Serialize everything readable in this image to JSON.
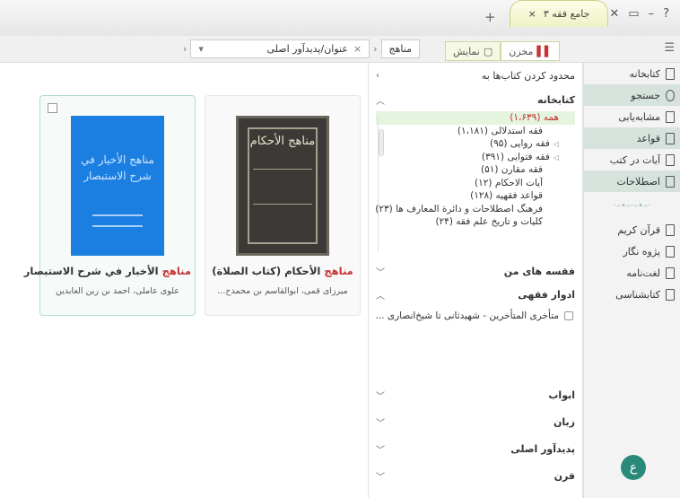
{
  "window": {
    "app_tab_title": "جامع فقه ۳",
    "controls": [
      "?",
      "–",
      "▭",
      "✕"
    ]
  },
  "breadcrumb": {
    "first": "مناهج",
    "second": "عنوان/پدیدآور اصلی",
    "second_close": "×"
  },
  "view_tabs": [
    {
      "label": "مخزن",
      "active": true
    },
    {
      "label": "نمایش",
      "active": false
    }
  ],
  "nav": {
    "items": [
      {
        "label": "کتابخانه",
        "highlight": false
      },
      {
        "label": "جستجو",
        "highlight": true
      },
      {
        "label": "مشابه‌یابی",
        "highlight": false
      },
      {
        "label": "قواعد",
        "highlight": true
      },
      {
        "label": "آیات در کتب",
        "highlight": false
      },
      {
        "label": "اصطلاحات",
        "highlight": true
      }
    ],
    "items2": [
      {
        "label": "قرآن کریم"
      },
      {
        "label": "پژوه نگار"
      },
      {
        "label": "لغت‌نامه"
      },
      {
        "label": "کتابشناسی"
      }
    ]
  },
  "filter": {
    "header": "محدود کردن کتاب‌ها به",
    "library": {
      "title": "کتابخانه",
      "items": [
        {
          "label": "همه (۱،۶۳۹)",
          "selected": true,
          "indent": false,
          "expandable": false
        },
        {
          "label": "فقه استدلالی (۱،۱۸۱)",
          "selected": false,
          "indent": false,
          "expandable": false
        },
        {
          "label": "فقه روایی (۹۵)",
          "selected": false,
          "indent": false,
          "expandable": true
        },
        {
          "label": "فقه فتوایی (۳۹۱)",
          "selected": false,
          "indent": false,
          "expandable": true
        },
        {
          "label": "فقه مقارن (۵۱)",
          "selected": false,
          "indent": false,
          "expandable": false
        },
        {
          "label": "آیات الاحکام (۱۲)",
          "selected": false,
          "indent": false,
          "expandable": false
        },
        {
          "label": "قواعد فقهیه (۱۲۸)",
          "selected": false,
          "indent": false,
          "expandable": false
        },
        {
          "label": "فرهنگ اصطلاحات و دائرة المعارف ها (۲۳)",
          "selected": false,
          "indent": false,
          "expandable": false
        },
        {
          "label": "کلیات و تاریخ علم فقه (۲۴)",
          "selected": false,
          "indent": false,
          "expandable": false
        }
      ]
    },
    "sections_mid": [
      {
        "title": "فقسه های من",
        "expanded": false
      },
      {
        "title": "ادوار فقهی",
        "expanded": true
      }
    ],
    "era_option": "متأخری المتأخرین - شهیدثانی تا شیخ‌انصاری ...",
    "sections_bottom": [
      {
        "title": "ابواب"
      },
      {
        "title": "زبان"
      },
      {
        "title": "پدیدآور اصلی"
      },
      {
        "title": "قرن"
      }
    ]
  },
  "books": [
    {
      "title_red": "مناهج",
      "title_rest": " الأحكام (كتاب الصلاة)",
      "author": "میرزای قمی، ابوالقاسم بن محمدح...",
      "cover_text": "مناهج الأحكام",
      "cover_style": "dark",
      "selected": false
    },
    {
      "title_red": "مناهج",
      "title_rest": " الأخبار في شرح الاستبصار",
      "author": "علوی عاملی، احمد بن زین العابدین",
      "cover_text": "مناهج الأخيار في شرح الاستبصار",
      "cover_style": "blue",
      "selected": true
    }
  ],
  "colors": {
    "accent_red": "#c83232",
    "nav_highlight": "#d5e3dc",
    "selected_row": "#e4f4de",
    "blue_cover": "#1a7fe0"
  }
}
